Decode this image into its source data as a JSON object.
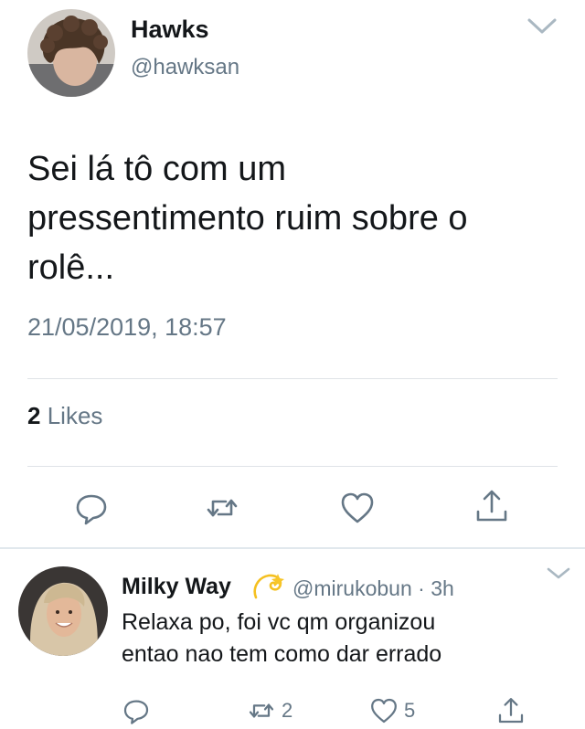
{
  "tweet": {
    "author_name": "Hawks",
    "author_handle": "@hawksan",
    "text_lines": [
      "Sei lá tô com um",
      "pressentimento ruim sobre o",
      "rolê..."
    ],
    "timestamp": "21/05/2019, 18:57",
    "likes_count": "2",
    "likes_label": "Likes"
  },
  "reply": {
    "author_name": "Milky Way",
    "author_handle": "@mirukobun",
    "separator": "·",
    "time": "3h",
    "text_lines": [
      "Relaxa po, foi vc qm organizou",
      "entao nao tem como dar errado"
    ],
    "retweet_count": "2",
    "like_count": "5"
  },
  "icons": {
    "reply": "comment-icon",
    "retweet": "retweet-icon",
    "like": "heart-icon",
    "share": "share-icon",
    "more": "chevron-down-icon",
    "badge": "dizzy-emoji-icon"
  },
  "colors": {
    "icon_gray": "#657786",
    "divider": "#dfe3e7",
    "text": "#14171a"
  }
}
